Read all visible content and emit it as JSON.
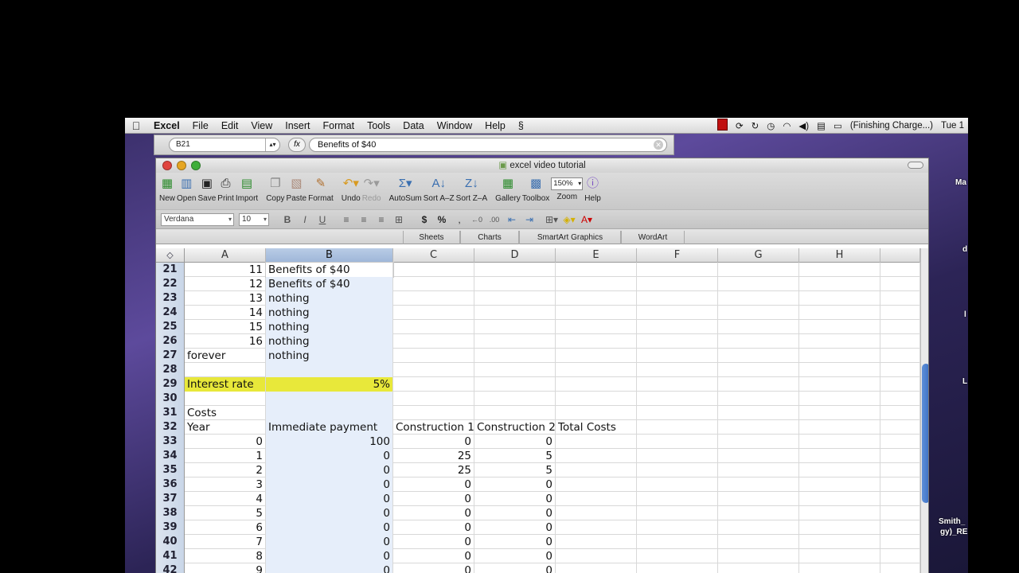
{
  "menubar": {
    "apple": "",
    "items": [
      "Excel",
      "File",
      "Edit",
      "View",
      "Insert",
      "Format",
      "Tools",
      "Data",
      "Window",
      "Help"
    ],
    "status_text": "(Finishing Charge...)",
    "clock": "Tue 1"
  },
  "formula_bar": {
    "name_box": "B21",
    "fx_label": "fx",
    "formula": "Benefits of $40"
  },
  "window": {
    "title": "excel video tutorial"
  },
  "toolbar": {
    "buttons": [
      "New",
      "Open",
      "Save",
      "Print",
      "Import",
      "Copy",
      "Paste",
      "Format",
      "Undo",
      "Redo",
      "AutoSum",
      "Sort A–Z",
      "Sort Z–A",
      "Gallery",
      "Toolbox",
      "Zoom",
      "Help"
    ],
    "zoom_value": "150%"
  },
  "format_bar": {
    "font": "Verdana",
    "size": "10"
  },
  "ribbon_tabs": [
    "Sheets",
    "Charts",
    "SmartArt Graphics",
    "WordArt"
  ],
  "columns": [
    "A",
    "B",
    "C",
    "D",
    "E",
    "F",
    "G",
    "H"
  ],
  "rows": [
    {
      "n": "21",
      "a": "11",
      "b": "Benefits of $40",
      "c": "",
      "d": "",
      "e": ""
    },
    {
      "n": "22",
      "a": "12",
      "b": "Benefits of $40",
      "c": "",
      "d": "",
      "e": ""
    },
    {
      "n": "23",
      "a": "13",
      "b": "nothing",
      "c": "",
      "d": "",
      "e": ""
    },
    {
      "n": "24",
      "a": "14",
      "b": "nothing",
      "c": "",
      "d": "",
      "e": ""
    },
    {
      "n": "25",
      "a": "15",
      "b": "nothing",
      "c": "",
      "d": "",
      "e": ""
    },
    {
      "n": "26",
      "a": "16",
      "b": "nothing",
      "c": "",
      "d": "",
      "e": ""
    },
    {
      "n": "27",
      "a": "forever",
      "b": "nothing",
      "c": "",
      "d": "",
      "e": ""
    },
    {
      "n": "28",
      "a": "",
      "b": "",
      "c": "",
      "d": "",
      "e": ""
    },
    {
      "n": "29",
      "a": "Interest rate",
      "b": "5%",
      "c": "",
      "d": "",
      "e": ""
    },
    {
      "n": "30",
      "a": "",
      "b": "",
      "c": "",
      "d": "",
      "e": ""
    },
    {
      "n": "31",
      "a": "Costs",
      "b": "",
      "c": "",
      "d": "",
      "e": ""
    },
    {
      "n": "32",
      "a": "Year",
      "b": "Immediate payment",
      "c": "Construction 1",
      "d": "Construction 2",
      "e": "Total Costs"
    },
    {
      "n": "33",
      "a": "0",
      "b": "100",
      "c": "0",
      "d": "0",
      "e": ""
    },
    {
      "n": "34",
      "a": "1",
      "b": "0",
      "c": "25",
      "d": "5",
      "e": ""
    },
    {
      "n": "35",
      "a": "2",
      "b": "0",
      "c": "25",
      "d": "5",
      "e": ""
    },
    {
      "n": "36",
      "a": "3",
      "b": "0",
      "c": "0",
      "d": "0",
      "e": ""
    },
    {
      "n": "37",
      "a": "4",
      "b": "0",
      "c": "0",
      "d": "0",
      "e": ""
    },
    {
      "n": "38",
      "a": "5",
      "b": "0",
      "c": "0",
      "d": "0",
      "e": ""
    },
    {
      "n": "39",
      "a": "6",
      "b": "0",
      "c": "0",
      "d": "0",
      "e": ""
    },
    {
      "n": "40",
      "a": "7",
      "b": "0",
      "c": "0",
      "d": "0",
      "e": ""
    },
    {
      "n": "41",
      "a": "8",
      "b": "0",
      "c": "0",
      "d": "0",
      "e": ""
    },
    {
      "n": "42",
      "a": "9",
      "b": "0",
      "c": "0",
      "d": "0",
      "e": ""
    }
  ],
  "desktop_labels": [
    "Ma",
    "d",
    "l",
    "L",
    "Smith_",
    "gy)_RE"
  ],
  "colors": {
    "selection": "#e6eefa",
    "highlight": "#e8e83a",
    "scroll_thumb": "#3a6fc4"
  }
}
